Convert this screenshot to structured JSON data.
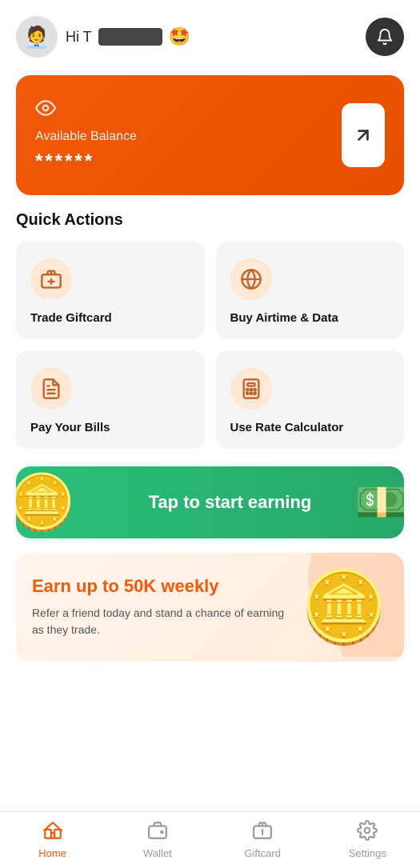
{
  "header": {
    "greeting": "Hi T",
    "emoji": "🤩",
    "avatar_emoji": "🧑‍💼"
  },
  "balance_card": {
    "label": "Available Balance",
    "amount": "******",
    "arrow": "↗",
    "eye_icon": "👁"
  },
  "quick_actions": {
    "title": "Quick Actions",
    "items": [
      {
        "id": "trade-giftcard",
        "label": "Trade Giftcard",
        "icon": "🎁"
      },
      {
        "id": "buy-airtime",
        "label": "Buy Airtime & Data",
        "icon": "🌐"
      },
      {
        "id": "pay-bills",
        "label": "Pay Your Bills",
        "icon": "🧾"
      },
      {
        "id": "rate-calculator",
        "label": "Use Rate Calculator",
        "icon": "🧮"
      }
    ]
  },
  "earn_banner": {
    "text": "Tap to start earning",
    "coin_emoji": "🪙",
    "money_emoji": "💵"
  },
  "refer_banner": {
    "title": "Earn up to 50K weekly",
    "description": "Refer a friend today and stand a chance of earning as they trade.",
    "coin_emoji": "🪙"
  },
  "bottom_nav": {
    "items": [
      {
        "id": "home",
        "label": "Home",
        "icon": "🏠",
        "active": true
      },
      {
        "id": "wallet",
        "label": "Wallet",
        "icon": "👛",
        "active": false
      },
      {
        "id": "giftcard",
        "label": "Giftcard",
        "icon": "🎴",
        "active": false
      },
      {
        "id": "settings",
        "label": "Settings",
        "icon": "⚙️",
        "active": false
      }
    ]
  }
}
